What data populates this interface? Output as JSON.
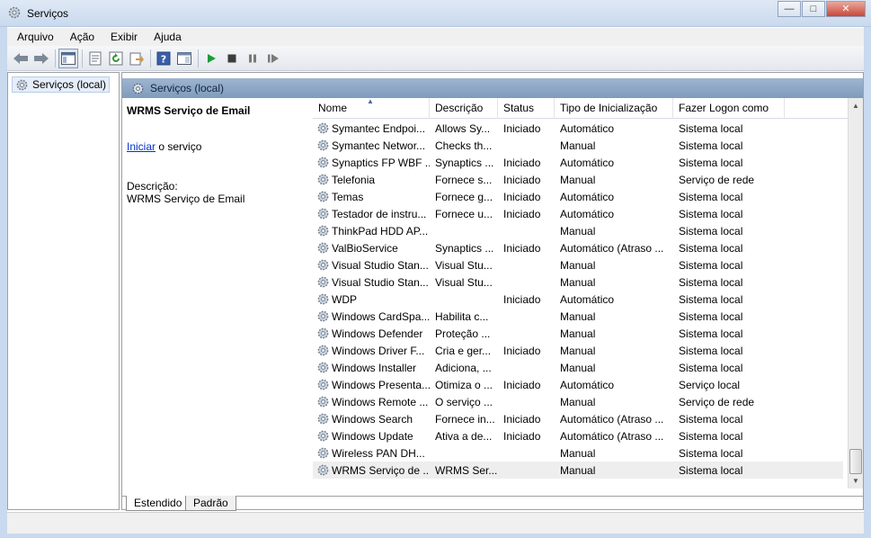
{
  "window": {
    "title": "Serviços",
    "minimize": "—",
    "maximize": "□",
    "close": "✕"
  },
  "menu": [
    "Arquivo",
    "Ação",
    "Exibir",
    "Ajuda"
  ],
  "tree": {
    "item": "Serviços (local)"
  },
  "pane_header": "Serviços (local)",
  "details": {
    "service_name": "WRMS Serviço de Email",
    "start_link": "Iniciar",
    "start_suffix": " o serviço",
    "desc_label": "Descrição:",
    "desc_text": "WRMS Serviço de Email"
  },
  "columns": [
    "Nome",
    "Descrição",
    "Status",
    "Tipo de Inicialização",
    "Fazer Logon como"
  ],
  "rows": [
    {
      "name": "Symantec Endpoi...",
      "desc": "Allows Sy...",
      "status": "Iniciado",
      "tipo": "Automático",
      "logon": "Sistema local"
    },
    {
      "name": "Symantec Networ...",
      "desc": "Checks th...",
      "status": "",
      "tipo": "Manual",
      "logon": "Sistema local"
    },
    {
      "name": "Synaptics FP WBF ...",
      "desc": "Synaptics ...",
      "status": "Iniciado",
      "tipo": "Automático",
      "logon": "Sistema local"
    },
    {
      "name": "Telefonia",
      "desc": "Fornece s...",
      "status": "Iniciado",
      "tipo": "Manual",
      "logon": "Serviço de rede"
    },
    {
      "name": "Temas",
      "desc": "Fornece g...",
      "status": "Iniciado",
      "tipo": "Automático",
      "logon": "Sistema local"
    },
    {
      "name": "Testador de instru...",
      "desc": "Fornece u...",
      "status": "Iniciado",
      "tipo": "Automático",
      "logon": "Sistema local"
    },
    {
      "name": "ThinkPad HDD AP...",
      "desc": "",
      "status": "",
      "tipo": "Manual",
      "logon": "Sistema local"
    },
    {
      "name": "ValBioService",
      "desc": "Synaptics ...",
      "status": "Iniciado",
      "tipo": "Automático (Atraso ...",
      "logon": "Sistema local"
    },
    {
      "name": "Visual Studio Stan...",
      "desc": "Visual Stu...",
      "status": "",
      "tipo": "Manual",
      "logon": "Sistema local"
    },
    {
      "name": "Visual Studio Stan...",
      "desc": "Visual Stu...",
      "status": "",
      "tipo": "Manual",
      "logon": "Sistema local"
    },
    {
      "name": "WDP",
      "desc": "",
      "status": "Iniciado",
      "tipo": "Automático",
      "logon": "Sistema local"
    },
    {
      "name": "Windows CardSpa...",
      "desc": "Habilita c...",
      "status": "",
      "tipo": "Manual",
      "logon": "Sistema local"
    },
    {
      "name": "Windows Defender",
      "desc": "Proteção ...",
      "status": "",
      "tipo": "Manual",
      "logon": "Sistema local"
    },
    {
      "name": "Windows Driver F...",
      "desc": "Cria e ger...",
      "status": "Iniciado",
      "tipo": "Manual",
      "logon": "Sistema local"
    },
    {
      "name": "Windows Installer",
      "desc": "Adiciona, ...",
      "status": "",
      "tipo": "Manual",
      "logon": "Sistema local"
    },
    {
      "name": "Windows Presenta...",
      "desc": "Otimiza o ...",
      "status": "Iniciado",
      "tipo": "Automático",
      "logon": "Serviço local"
    },
    {
      "name": "Windows Remote ...",
      "desc": "O serviço ...",
      "status": "",
      "tipo": "Manual",
      "logon": "Serviço de rede"
    },
    {
      "name": "Windows Search",
      "desc": "Fornece in...",
      "status": "Iniciado",
      "tipo": "Automático (Atraso ...",
      "logon": "Sistema local"
    },
    {
      "name": "Windows Update",
      "desc": "Ativa a de...",
      "status": "Iniciado",
      "tipo": "Automático (Atraso ...",
      "logon": "Sistema local"
    },
    {
      "name": "Wireless PAN DH...",
      "desc": "",
      "status": "",
      "tipo": "Manual",
      "logon": "Sistema local"
    },
    {
      "name": "WRMS Serviço de ...",
      "desc": "WRMS Ser...",
      "status": "",
      "tipo": "Manual",
      "logon": "Sistema local",
      "selected": true
    }
  ],
  "tabs": [
    "Estendido",
    "Padrão"
  ],
  "scroll": {
    "up": "▲",
    "down": "▼"
  }
}
